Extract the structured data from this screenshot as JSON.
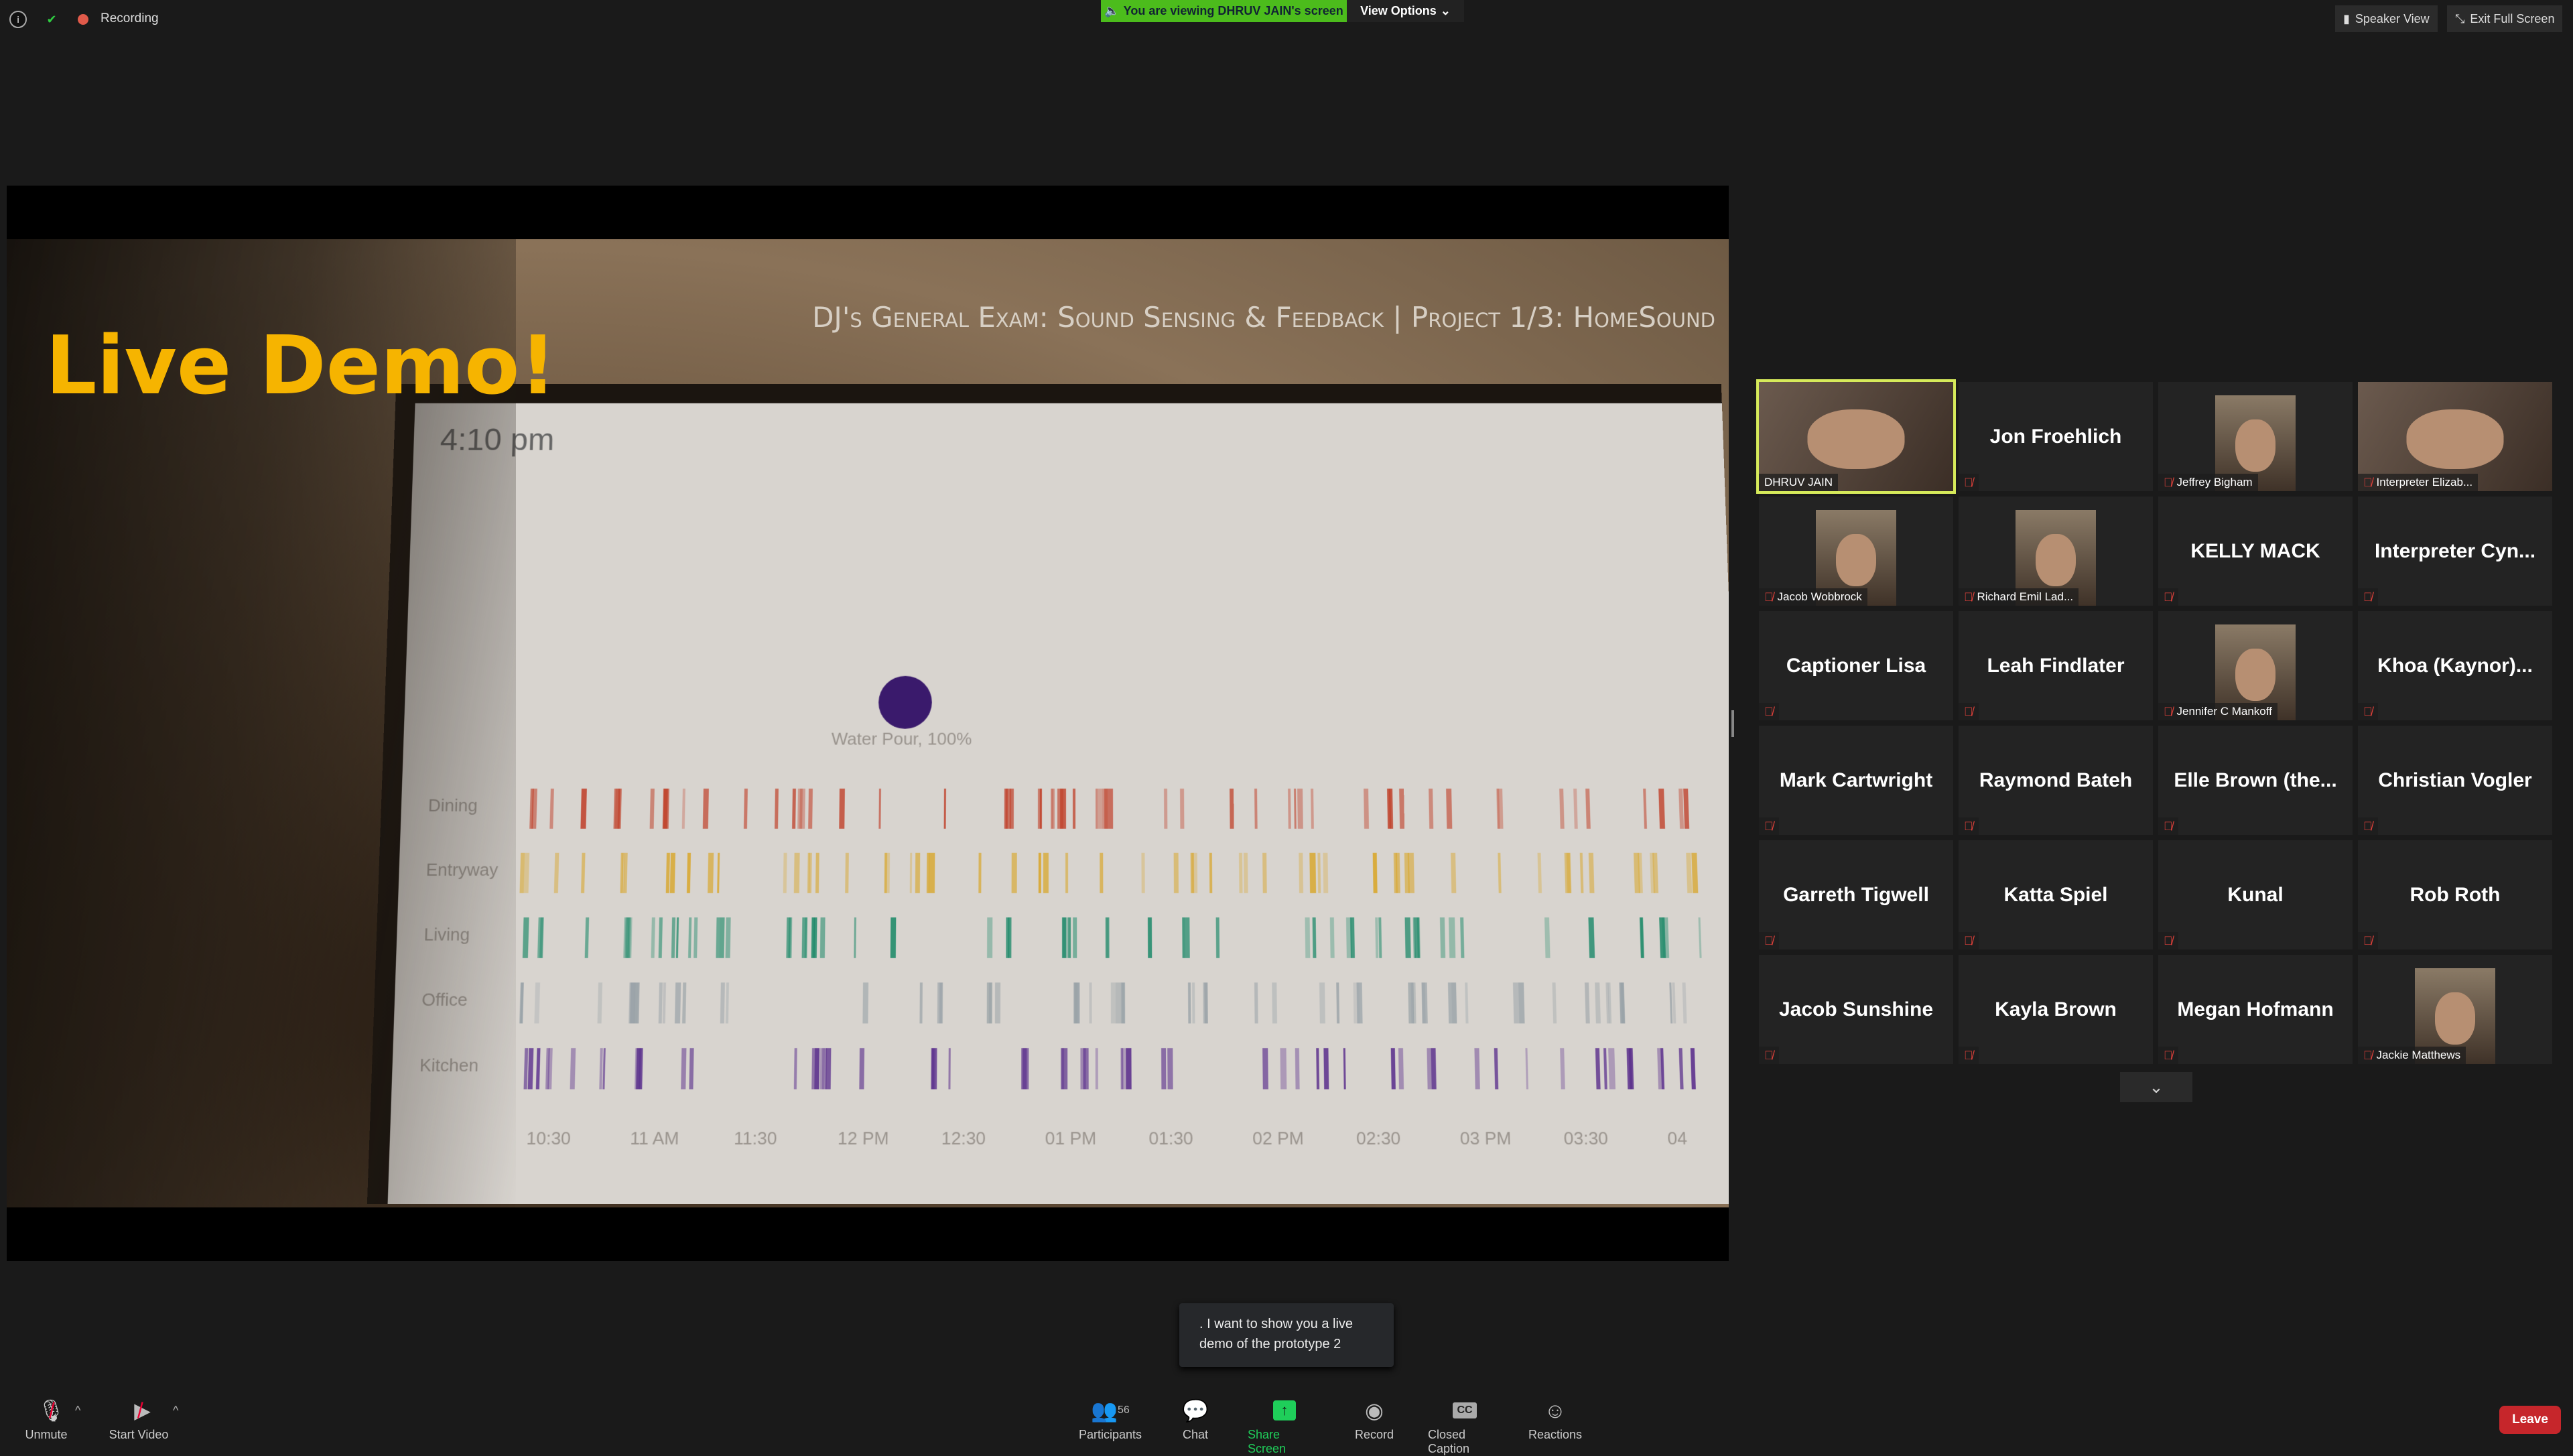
{
  "topbar": {
    "recording_label": "Recording",
    "banner": "You are viewing DHRUV JAIN's screen",
    "view_options": "View Options",
    "speaker_view": "Speaker View",
    "exit_full_screen": "Exit Full Screen"
  },
  "slide": {
    "heading": "Live Demo!",
    "title": "DJ's General Exam: Sound Sensing & Feedback | Project 1/3: HomeSound",
    "tablet": {
      "time": "4:10 pm",
      "event": "Water Pour, 100%",
      "rows": [
        "Dining",
        "Entryway",
        "Living",
        "Office",
        "Kitchen"
      ],
      "times": [
        "10:30",
        "11 AM",
        "11:30",
        "12 PM",
        "12:30",
        "01 PM",
        "01:30",
        "02 PM",
        "02:30",
        "03 PM",
        "03:30",
        "04"
      ],
      "row_colors": [
        "#c0432d",
        "#d8a62a",
        "#1f8a6a",
        "#9aa3a8",
        "#5a2e8c"
      ]
    }
  },
  "participants": [
    {
      "name": "DHRUV JAIN",
      "video": true,
      "active": true,
      "muted": false
    },
    {
      "name": "Jon Froehlich",
      "video": false,
      "muted": true
    },
    {
      "name": "Jeffrey Bigham",
      "video": true,
      "muted": true
    },
    {
      "name": "Interpreter Elizab...",
      "video": true,
      "full": true,
      "muted": true
    },
    {
      "name": "Jacob Wobbrock",
      "video": true,
      "muted": true
    },
    {
      "name": "Richard Emil Lad...",
      "video": true,
      "muted": true
    },
    {
      "name": "KELLY MACK",
      "video": false,
      "muted": true
    },
    {
      "name": "Interpreter  Cyn...",
      "video": false,
      "muted": true
    },
    {
      "name": "Captioner Lisa",
      "video": false,
      "muted": true
    },
    {
      "name": "Leah Findlater",
      "video": false,
      "muted": true
    },
    {
      "name": "Jennifer C Mankoff",
      "video": true,
      "muted": true
    },
    {
      "name": "Khoa  (Kaynor)...",
      "video": false,
      "muted": true
    },
    {
      "name": "Mark Cartwright",
      "video": false,
      "muted": true
    },
    {
      "name": "Raymond Bateh",
      "video": false,
      "muted": true
    },
    {
      "name": "Elle Brown  (the...",
      "video": false,
      "muted": true
    },
    {
      "name": "Christian Vogler",
      "video": false,
      "muted": true
    },
    {
      "name": "Garreth Tigwell",
      "video": false,
      "muted": true
    },
    {
      "name": "Katta Spiel",
      "video": false,
      "muted": true
    },
    {
      "name": "Kunal",
      "video": false,
      "muted": true
    },
    {
      "name": "Rob Roth",
      "video": false,
      "muted": true
    },
    {
      "name": "Jacob Sunshine",
      "video": false,
      "muted": true
    },
    {
      "name": "Kayla Brown",
      "video": false,
      "muted": true
    },
    {
      "name": "Megan Hofmann",
      "video": false,
      "muted": true
    },
    {
      "name": "Jackie Matthews",
      "video": true,
      "muted": true
    }
  ],
  "caption": {
    "text": ".   I want to show you a live demo of the prototype 2"
  },
  "toolbar": {
    "unmute": "Unmute",
    "start_video": "Start Video",
    "participants": "Participants",
    "participants_count": "56",
    "chat": "Chat",
    "share_screen": "Share Screen",
    "record": "Record",
    "closed_caption": "Closed Caption",
    "reactions": "Reactions",
    "leave": "Leave"
  },
  "colors": {
    "banner": "#4cbc1c",
    "active_speaker": "#d6ea5a",
    "leave": "#c6262b",
    "share": "#1fce5a",
    "heading": "#f6b400"
  }
}
